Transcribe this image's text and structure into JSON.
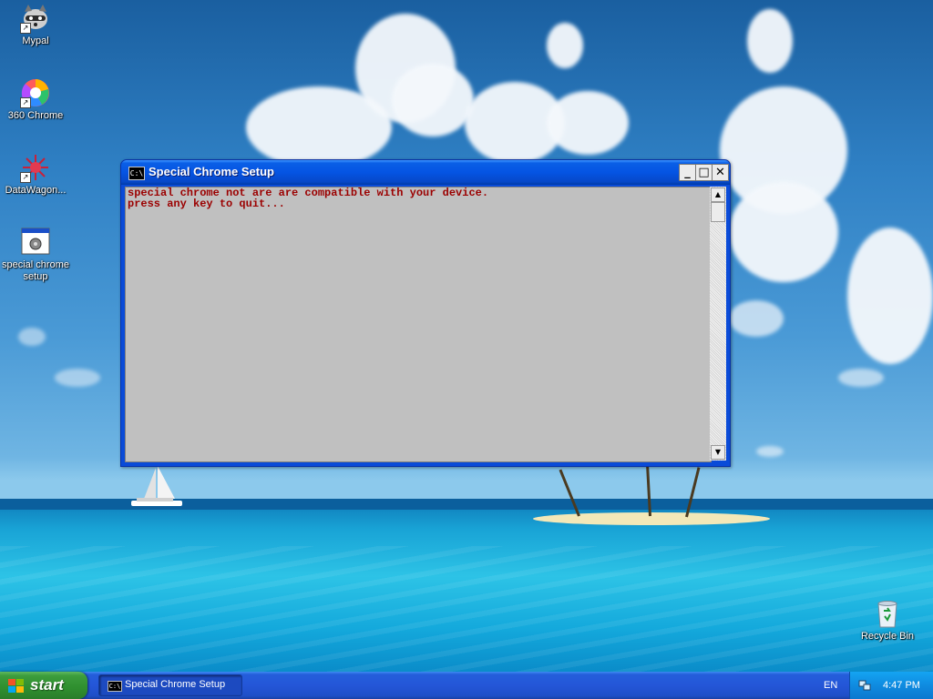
{
  "desktop": {
    "icons": [
      {
        "label": "Mypal",
        "icon": "raccoon-icon"
      },
      {
        "label": "360 Chrome",
        "icon": "browser-icon"
      },
      {
        "label": "DataWagon...",
        "icon": "splat-icon"
      },
      {
        "label": "special chrome setup",
        "icon": "console-app-icon"
      },
      {
        "label": "Recycle Bin",
        "icon": "recycle-bin-icon"
      }
    ]
  },
  "window": {
    "title": "Special Chrome Setup",
    "icon_text": "C:\\",
    "console_lines": [
      "special chrome not are are compatible with your device.",
      "press any key to quit..."
    ],
    "console_text_color": "#9b0000",
    "console_bg_color": "#c0c0c0"
  },
  "taskbar": {
    "start_label": "start",
    "task_button_label": "Special Chrome Setup",
    "language": "EN",
    "clock": "4:47 PM"
  }
}
